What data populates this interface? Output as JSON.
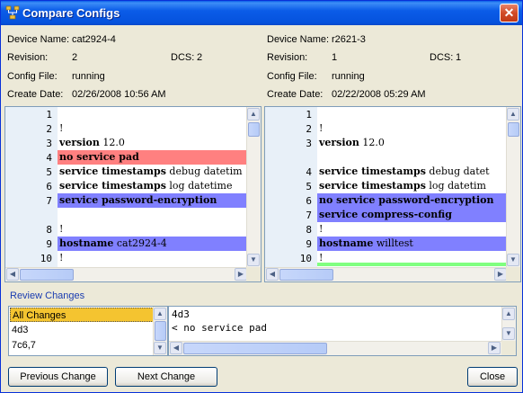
{
  "window": {
    "title": "Compare Configs",
    "close_glyph": "✕"
  },
  "left": {
    "device_label": "Device Name:",
    "device_value": "cat2924-4",
    "revision_label": "Revision:",
    "revision_value": "2",
    "dcs_label": "DCS:",
    "dcs_value": "2",
    "config_label": "Config File:",
    "config_value": "running",
    "date_label": "Create Date:",
    "date_value": "02/26/2008 10:56 AM",
    "lines": [
      {
        "num": "1",
        "text": "",
        "bold": "",
        "hl": ""
      },
      {
        "num": "2",
        "text": "!",
        "bold": "",
        "hl": ""
      },
      {
        "num": "3",
        "text": " 12.0",
        "bold": "version",
        "hl": ""
      },
      {
        "num": "4",
        "text": "",
        "bold": "no service pad",
        "hl": "red"
      },
      {
        "num": "5",
        "text": " debug datetim",
        "bold": "service timestamps",
        "hl": ""
      },
      {
        "num": "6",
        "text": " log datetime",
        "bold": "service timestamps",
        "hl": ""
      },
      {
        "num": "7",
        "text": "",
        "bold": "service password-encryption",
        "hl": "blue"
      },
      {
        "num": "",
        "text": "",
        "bold": "",
        "hl": ""
      },
      {
        "num": "8",
        "text": "!",
        "bold": "",
        "hl": ""
      },
      {
        "num": "9",
        "text": " cat2924-4",
        "bold": "hostname",
        "hl": "blue"
      },
      {
        "num": "10",
        "text": "!",
        "bold": "",
        "hl": ""
      }
    ]
  },
  "right": {
    "device_label": "Device Name:",
    "device_value": "r2621-3",
    "revision_label": "Revision:",
    "revision_value": "1",
    "dcs_label": "DCS:",
    "dcs_value": "1",
    "config_label": "Config File:",
    "config_value": "running",
    "date_label": "Create Date:",
    "date_value": "02/22/2008 05:29 AM",
    "lines": [
      {
        "num": "1",
        "text": "",
        "bold": "",
        "hl": ""
      },
      {
        "num": "2",
        "text": "!",
        "bold": "",
        "hl": ""
      },
      {
        "num": "3",
        "text": " 12.0",
        "bold": "version",
        "hl": ""
      },
      {
        "num": "",
        "text": "",
        "bold": "",
        "hl": ""
      },
      {
        "num": "4",
        "text": " debug datet",
        "bold": "service timestamps",
        "hl": ""
      },
      {
        "num": "5",
        "text": " log datetim",
        "bold": "service timestamps",
        "hl": ""
      },
      {
        "num": "6",
        "text": "",
        "bold": "no service password-encryption",
        "hl": "blue"
      },
      {
        "num": "7",
        "text": "",
        "bold": "service compress-config",
        "hl": "blue"
      },
      {
        "num": "8",
        "text": "!",
        "bold": "",
        "hl": ""
      },
      {
        "num": "9",
        "text": " willtest",
        "bold": "hostname",
        "hl": "blue"
      },
      {
        "num": "10",
        "text": "!",
        "bold": "",
        "hl": "green"
      }
    ]
  },
  "review": {
    "label": "Review Changes",
    "items": [
      "All Changes",
      "4d3",
      "7c6,7"
    ],
    "selected_index": 0,
    "diff_lines": [
      "4d3",
      "< no service pad",
      "---"
    ]
  },
  "buttons": {
    "previous": "Previous Change",
    "next": "Next Change",
    "close": "Close"
  },
  "colors": {
    "red": "#ff8080",
    "blue": "#8080ff",
    "green": "#80ff80",
    "gutter": "#e8f0f8"
  }
}
